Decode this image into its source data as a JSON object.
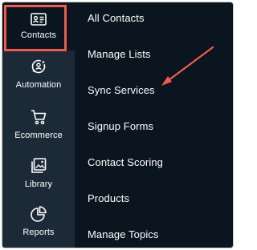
{
  "rail": {
    "items": [
      {
        "label": "Contacts",
        "icon": "contact-card-icon",
        "active": true
      },
      {
        "label": "Automation",
        "icon": "automation-gear-icon",
        "active": false
      },
      {
        "label": "Ecommerce",
        "icon": "shopping-cart-icon",
        "active": false
      },
      {
        "label": "Library",
        "icon": "image-library-icon",
        "active": false
      },
      {
        "label": "Reports",
        "icon": "pie-chart-icon",
        "active": false
      }
    ]
  },
  "submenu": {
    "items": [
      "All Contacts",
      "Manage Lists",
      "Sync Services",
      "Signup Forms",
      "Contact Scoring",
      "Products",
      "Manage Topics"
    ]
  },
  "annotation": {
    "highlight_color": "#ef5b4c",
    "arrow_color": "#ef5b4c",
    "arrow_target": "Sync Services"
  },
  "colors": {
    "rail_bg": "#1c2a38",
    "menu_bg": "#0a1520",
    "text": "#ffffff"
  }
}
